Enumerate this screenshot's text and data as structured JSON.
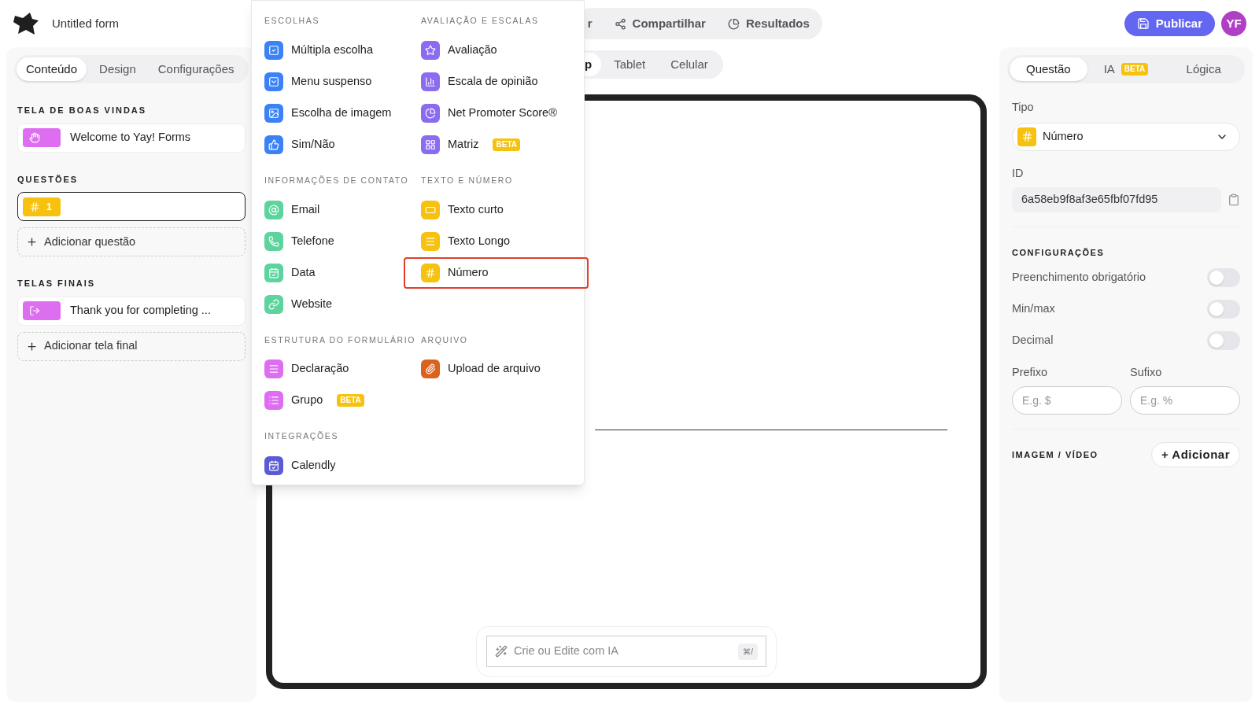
{
  "header": {
    "form_title": "Untitled form",
    "nav": [
      {
        "label": "r"
      },
      {
        "label": "Compartilhar"
      },
      {
        "label": "Resultados"
      }
    ],
    "publish": "Publicar",
    "avatar": "YF"
  },
  "left_panel": {
    "tabs": [
      {
        "label": "Conteúdo",
        "selected": true
      },
      {
        "label": "Design",
        "selected": false
      },
      {
        "label": "Configurações",
        "selected": false
      }
    ],
    "sections": [
      {
        "heading": "TELA DE BOAS VINDAS",
        "items": [
          {
            "kind": "welcome",
            "label": "Welcome to Yay! Forms",
            "color": "#dd6ef0",
            "selected": false
          }
        ]
      },
      {
        "heading": "QUESTÕES",
        "items": [
          {
            "kind": "number",
            "label": "1",
            "color": "#f7c20f",
            "selected": true
          }
        ],
        "add": "Adicionar questão"
      },
      {
        "heading": "TELAS FINAIS",
        "items": [
          {
            "kind": "ending",
            "label": "Thank you for completing ...",
            "color": "#dd6ef0",
            "selected": false
          }
        ],
        "add": "Adicionar tela final"
      }
    ]
  },
  "device_tabs": [
    {
      "label": "p",
      "selected": true
    },
    {
      "label": "Tablet",
      "selected": false
    },
    {
      "label": "Celular",
      "selected": false
    }
  ],
  "ai_bar": {
    "placeholder": "Crie ou Edite com IA",
    "shortcut": "⌘/"
  },
  "right_panel": {
    "tabs": [
      {
        "label": "Questão",
        "selected": true
      },
      {
        "label": "IA",
        "selected": false,
        "badge": "BETA"
      },
      {
        "label": "Lógica",
        "selected": false
      }
    ],
    "type_label": "Tipo",
    "type_value": {
      "label": "Número",
      "color": "#f7c20f"
    },
    "id_label": "ID",
    "id_value": "6a58eb9f8af3e65fbf07fd95",
    "config_heading": "CONFIGURAÇÕES",
    "toggles": [
      {
        "label": "Preenchimento obrigatório",
        "on": false
      },
      {
        "label": "Min/max",
        "on": false
      },
      {
        "label": "Decimal",
        "on": false
      }
    ],
    "prefix": {
      "label": "Prefixo",
      "placeholder": "E.g. $"
    },
    "suffix": {
      "label": "Sufixo",
      "placeholder": "E.g. %"
    },
    "media_heading": "IMAGEM / VÍDEO",
    "media_add": "+ Adicionar"
  },
  "question_menu": {
    "sections": [
      {
        "title": "ESCOLHAS",
        "items": [
          {
            "label": "Múltipla escolha",
            "color": "#3b82f6",
            "selected": false
          },
          {
            "label": "Menu suspenso",
            "color": "#3b82f6",
            "selected": false
          },
          {
            "label": "Escolha de imagem",
            "color": "#3b82f6",
            "selected": false
          },
          {
            "label": "Sim/Não",
            "color": "#3b82f6",
            "selected": false
          }
        ]
      },
      {
        "title": "AVALIAÇÃO E ESCALAS",
        "items": [
          {
            "label": "Avaliação",
            "color": "#8b6cf0",
            "selected": false
          },
          {
            "label": "Escala de opinião",
            "color": "#8b6cf0",
            "selected": false
          },
          {
            "label": "Net Promoter Score®",
            "color": "#8b6cf0",
            "selected": false
          },
          {
            "label": "Matriz",
            "color": "#8b6cf0",
            "selected": false,
            "badge": "BETA"
          }
        ]
      },
      {
        "title": "INFORMAÇÕES DE CONTATO",
        "items": [
          {
            "label": "Email",
            "color": "#5dd39e",
            "selected": false
          },
          {
            "label": "Telefone",
            "color": "#5dd39e",
            "selected": false
          },
          {
            "label": "Data",
            "color": "#5dd39e",
            "selected": false
          },
          {
            "label": "Website",
            "color": "#5dd39e",
            "selected": false
          }
        ]
      },
      {
        "title": "TEXTO E NÚMERO",
        "items": [
          {
            "label": "Texto curto",
            "color": "#f7c20f",
            "selected": false
          },
          {
            "label": "Texto Longo",
            "color": "#f7c20f",
            "selected": false
          },
          {
            "label": "Número",
            "color": "#f7c20f",
            "selected": true
          }
        ]
      },
      {
        "title": "ESTRUTURA DO FORMULÁRIO",
        "items": [
          {
            "label": "Declaração",
            "color": "#dd6ef0",
            "selected": false
          },
          {
            "label": "Grupo",
            "color": "#dd6ef0",
            "selected": false,
            "badge": "BETA"
          }
        ]
      },
      {
        "title": "ARQUIVO",
        "items": [
          {
            "label": "Upload de arquivo",
            "color": "#d9631e",
            "selected": false
          }
        ]
      },
      {
        "title": "INTEGRAÇÕES",
        "items": [
          {
            "label": "Calendly",
            "color": "#5b5bd6",
            "selected": false
          }
        ]
      }
    ]
  }
}
